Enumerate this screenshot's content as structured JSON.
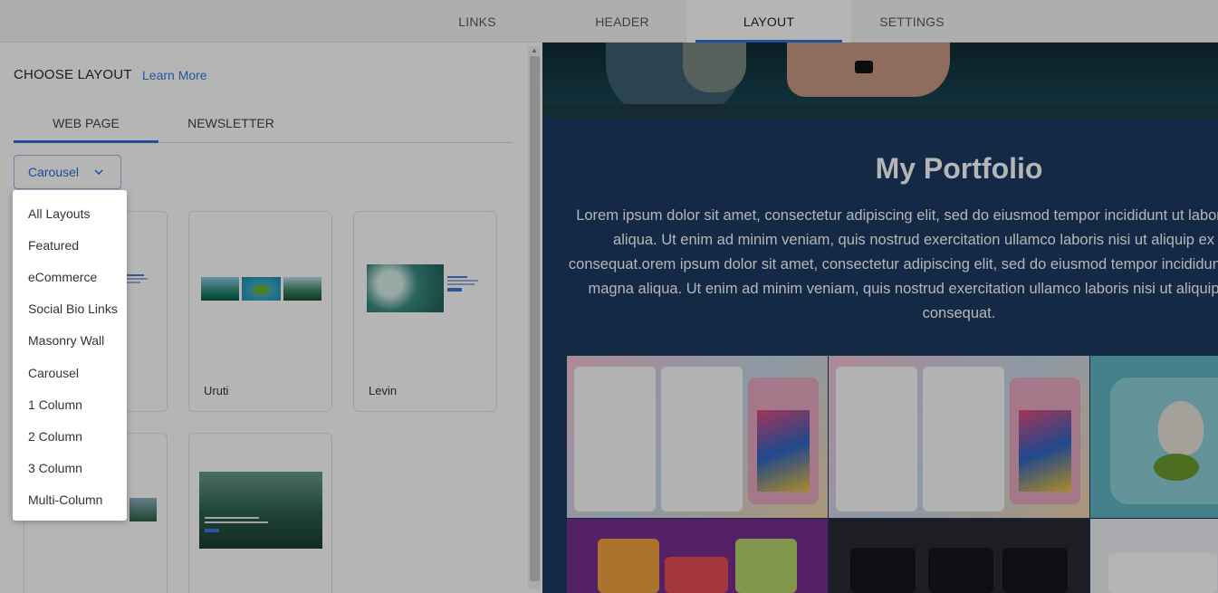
{
  "top_tabs": [
    {
      "label": "LINKS"
    },
    {
      "label": "HEADER"
    },
    {
      "label": "LAYOUT"
    },
    {
      "label": "SETTINGS"
    }
  ],
  "left_panel": {
    "title": "CHOOSE LAYOUT",
    "learn_more": "Learn More",
    "sub_tabs": [
      {
        "label": "WEB PAGE"
      },
      {
        "label": "NEWSLETTER"
      }
    ],
    "dropdown_value": "Carousel",
    "cards": [
      {
        "label": ""
      },
      {
        "label": "Uruti"
      },
      {
        "label": "Levin"
      }
    ]
  },
  "menu": {
    "items": [
      "All Layouts",
      "Featured",
      "eCommerce",
      "Social Bio Links",
      "Masonry Wall",
      "Carousel",
      "1 Column",
      "2 Column",
      "3 Column",
      "Multi-Column"
    ]
  },
  "preview": {
    "title": "My Portfolio",
    "body": "Lorem ipsum dolor sit amet, consectetur adipiscing elit, sed do eiusmod tempor incididunt ut labore et dolore magna aliqua. Ut enim ad minim veniam, quis nostrud exercitation ullamco laboris nisi ut aliquip ex ea commodo consequat.orem ipsum dolor sit amet, consectetur adipiscing elit, sed do eiusmod tempor incididunt ut labore et dolore magna aliqua. Ut enim ad minim veniam, quis nostrud exercitation ullamco laboris nisi ut aliquip ex ea commodo consequat."
  },
  "colors": {
    "accent": "#2f73d8",
    "preview_bg": "#1b3a63"
  }
}
